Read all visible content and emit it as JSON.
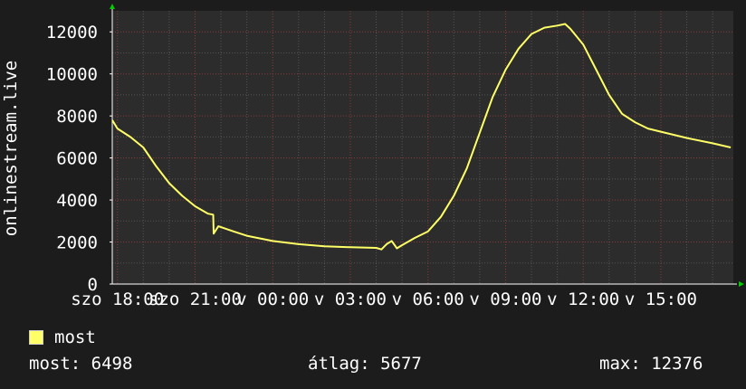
{
  "chart_data": {
    "type": "line",
    "ylabel": "onlinestream.live",
    "ylim": [
      0,
      13000
    ],
    "y_ticks": [
      0,
      2000,
      4000,
      6000,
      8000,
      10000,
      12000
    ],
    "x_tick_labels": [
      "szo 18:00",
      "szo 21:00",
      "v 00:00",
      "v 03:00",
      "v 06:00",
      "v 09:00",
      "v 12:00",
      "v 15:00"
    ],
    "x_range_hours": [
      -0.2,
      23.8
    ],
    "grid": true,
    "legend_position": "bottom-left",
    "series": [
      {
        "name": "most",
        "color": "#ffff66",
        "x": [
          -0.2,
          0.0,
          0.5,
          1.0,
          1.5,
          2.0,
          2.5,
          3.0,
          3.5,
          3.7,
          3.72,
          3.9,
          4.5,
          5.0,
          6.0,
          7.0,
          8.0,
          9.0,
          10.0,
          10.2,
          10.4,
          10.6,
          10.8,
          11.0,
          11.5,
          12.0,
          12.5,
          13.0,
          13.5,
          14.0,
          14.5,
          15.0,
          15.5,
          16.0,
          16.5,
          17.0,
          17.3,
          17.5,
          18.0,
          18.5,
          19.0,
          19.5,
          20.0,
          20.5,
          21.0,
          22.0,
          23.0,
          23.7
        ],
        "values": [
          7800,
          7400,
          7000,
          6500,
          5600,
          4800,
          4200,
          3700,
          3350,
          3300,
          2400,
          2750,
          2500,
          2300,
          2050,
          1900,
          1800,
          1750,
          1720,
          1650,
          1900,
          2050,
          1700,
          1850,
          2200,
          2500,
          3200,
          4200,
          5500,
          7200,
          8900,
          10200,
          11200,
          11900,
          12200,
          12300,
          12376,
          12150,
          11400,
          10200,
          9000,
          8100,
          7700,
          7400,
          7250,
          6950,
          6700,
          6498
        ]
      }
    ]
  },
  "legend": {
    "label": "most"
  },
  "stats": {
    "current": "most: 6498",
    "average": "átlag: 5677",
    "max": "max: 12376"
  }
}
